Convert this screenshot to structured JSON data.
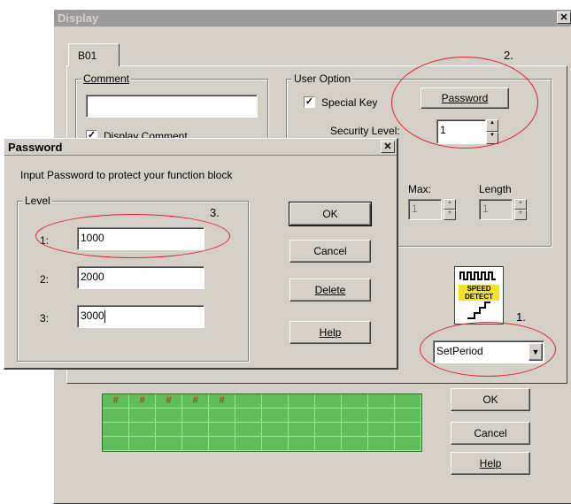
{
  "display_window": {
    "title": "Display",
    "close_glyph": "✕",
    "tab": "B01",
    "annotation_2": "2.",
    "annotation_1": "1.",
    "comment": {
      "legend": "Comment",
      "value": "",
      "display_comment_label": "Display Comment",
      "display_comment_checked": true
    },
    "user_option": {
      "legend": "User Option",
      "special_key_label": "Special Key",
      "special_key_checked": true,
      "password_button": "Password",
      "security_level_label": "Security Level:",
      "security_level_value": "1",
      "max_label": "Max:",
      "max_value": "1",
      "length_label": "Length",
      "length_value": "1"
    },
    "function_icon_text": [
      "SPEED",
      "DETECT"
    ],
    "mode_select": {
      "selected": "SetPeriod"
    },
    "buttons": {
      "ok": "OK",
      "cancel": "Cancel",
      "help": "Help"
    },
    "grid": {
      "marker": "#",
      "marked_cells": 5,
      "columns": 12,
      "rows": 4
    }
  },
  "password_dialog": {
    "title": "Password",
    "close_glyph": "✕",
    "prompt": "Input Password to protect your function block",
    "level_legend": "Level",
    "annotation_3": "3.",
    "levels": [
      {
        "label": "1:",
        "value": "1000"
      },
      {
        "label": "2:",
        "value": "2000"
      },
      {
        "label": "3:",
        "value": "3000"
      }
    ],
    "buttons": {
      "ok": "OK",
      "cancel": "Cancel",
      "delete": "Delete",
      "help": "Help"
    }
  },
  "colors": {
    "annotation_red": "#e8202a",
    "lcd_green": "#5fbd5a",
    "dialog_gray": "#d4d0c8"
  }
}
